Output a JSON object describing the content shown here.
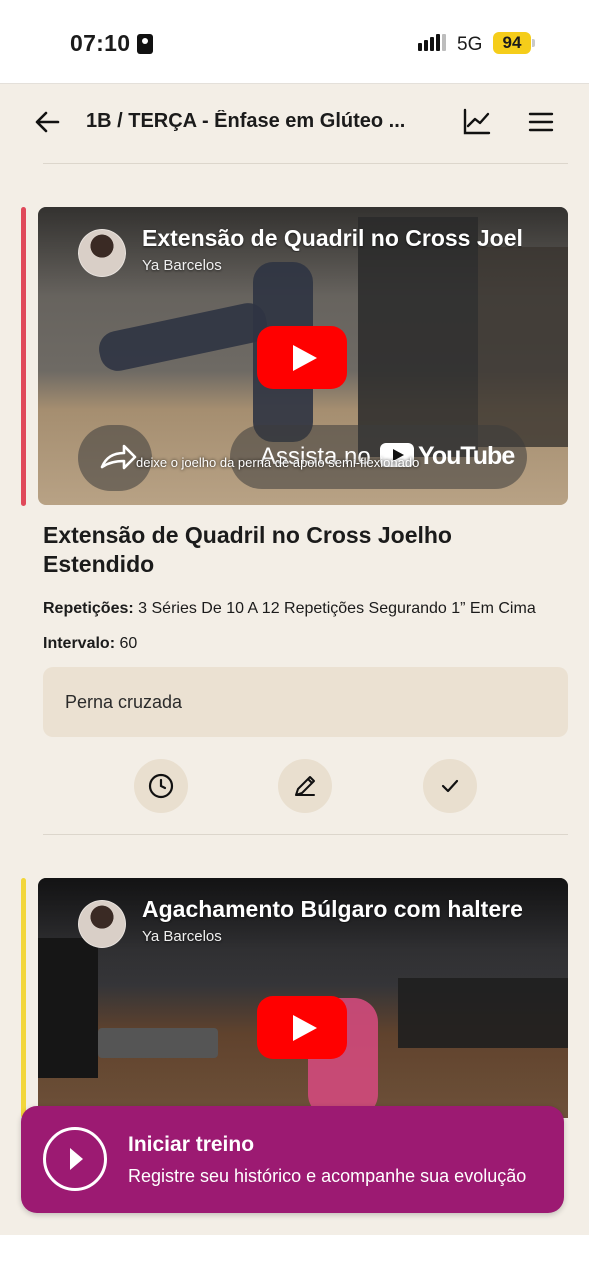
{
  "status_bar": {
    "time": "07:10",
    "network": "5G",
    "battery": "94"
  },
  "header": {
    "title": "1B / TERÇA - Ênfase em Glúteo ..."
  },
  "exercises": [
    {
      "accent_color": "#e0495a",
      "video": {
        "title": "Extensão de Quadril no Cross Joelho Estendido",
        "channel": "Ya Barcelos",
        "watch_on": "Assista no",
        "platform": "YouTube",
        "caption": "deixe o joelho da perna de apoio semi-flexionado"
      },
      "name": "Extensão de Quadril no Cross Joelho Estendido",
      "reps_label": "Repetições:",
      "reps_value": "3 Séries De 10 A 12 Repetições Segurando 1” Em Cima",
      "interval_label": "Intervalo:",
      "interval_value": "60",
      "note": "Perna cruzada",
      "actions": [
        "clock-icon",
        "pencil-icon",
        "check-icon"
      ]
    },
    {
      "accent_color": "#f2d63a",
      "video": {
        "title": "Agachamento Búlgaro com halteres",
        "channel": "Ya Barcelos"
      }
    }
  ],
  "cta": {
    "title": "Iniciar treino",
    "subtitle": "Registre seu histórico e acompanhe sua evolução",
    "color": "#9c1a72"
  }
}
